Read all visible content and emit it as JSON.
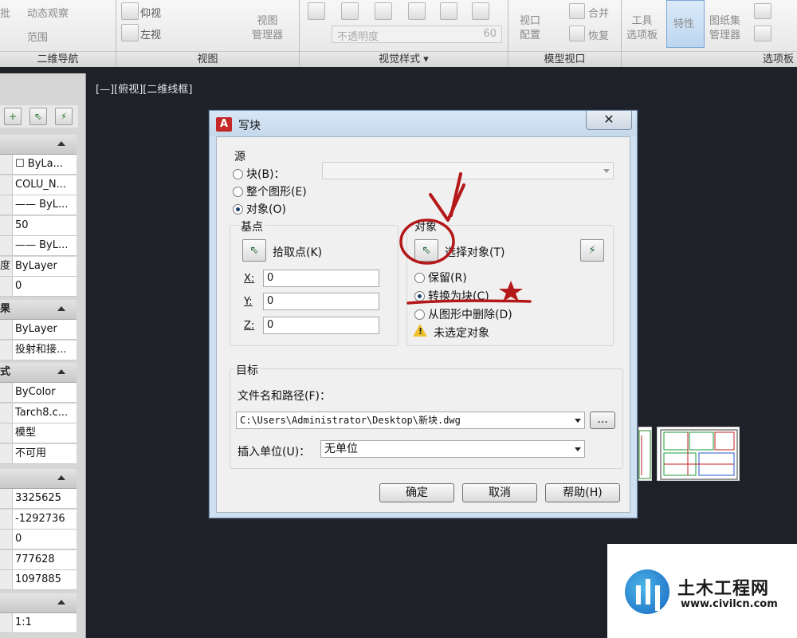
{
  "ribbon": {
    "nav_items": {
      "orbit": "动态观察",
      "range": "范围"
    },
    "nav_panel_label": "二维导航",
    "view_items": {
      "bottom_view": "仰视",
      "left_view": "左视"
    },
    "view_manager": "视图\n管理器",
    "view_panel_label": "视图",
    "visual_transparency": "不透明度",
    "visual_value": "60",
    "visual_panel_label": "视觉样式",
    "model_viewport": {
      "config": "视口\n配置",
      "merge": "合并",
      "restore": "恢复"
    },
    "model_panel_label": "模型视口",
    "palettes": {
      "tool": "工具\n选项板",
      "properties": "特性",
      "sheetset": "图纸集\n管理器"
    },
    "palettes_label": "选项板"
  },
  "palette": {
    "rows_general": [
      {
        "key": "",
        "value": "☐ ByLa..."
      },
      {
        "key": "",
        "value": "COLU_N..."
      },
      {
        "key": "",
        "value": "—— ByL..."
      },
      {
        "key": "",
        "value": "50"
      },
      {
        "key": "",
        "value": "—— ByL..."
      },
      {
        "key": "度",
        "value": "ByLayer"
      },
      {
        "key": "",
        "value": "0"
      }
    ],
    "section2_title": "果",
    "rows_3d": [
      {
        "key": "",
        "value": "ByLayer"
      },
      {
        "key": "",
        "value": "投射和接..."
      }
    ],
    "section3_title": "式",
    "rows_plot": [
      {
        "key": "",
        "value": "ByColor"
      },
      {
        "key": "",
        "value": "Tarch8.c..."
      },
      {
        "key": "",
        "value": "模型"
      },
      {
        "key": "",
        "value": "不可用"
      }
    ],
    "rows_view": [
      {
        "key": "",
        "value": "3325625"
      },
      {
        "key": "",
        "value": "-1292736"
      },
      {
        "key": "",
        "value": "0"
      },
      {
        "key": "",
        "value": "777628"
      },
      {
        "key": "",
        "value": "1097885"
      }
    ],
    "rows_misc": [
      {
        "key": "",
        "value": "1:1"
      }
    ]
  },
  "viewport": {
    "label": "[—][俯视][二维线框]"
  },
  "dialog": {
    "title": "写块",
    "source": {
      "title": "源",
      "block": "块(B)：",
      "entire": "整个图形(E)",
      "objects": "对象(O)"
    },
    "basepoint": {
      "title": "基点",
      "pick": "拾取点(K)",
      "x_label": "X:",
      "x_value": "0",
      "y_label": "Y:",
      "y_value": "0",
      "z_label": "Z:",
      "z_value": "0"
    },
    "objects": {
      "title": "对象",
      "select": "选择对象(T)",
      "retain": "保留(R)",
      "convert": "转换为块(C)",
      "delete": "从图形中删除(D)",
      "warning": "未选定对象"
    },
    "destination": {
      "title": "目标",
      "path_label": "文件名和路径(F)：",
      "path_value": "C:\\Users\\Administrator\\Desktop\\新块.dwg",
      "browse": "...",
      "units_label": "插入单位(U)：",
      "units_value": "无单位"
    },
    "buttons": {
      "ok": "确定",
      "cancel": "取消",
      "help": "帮助(H)"
    },
    "close": "✕"
  },
  "watermark": {
    "name": "土木工程网",
    "url": "www.civilcn.com"
  }
}
